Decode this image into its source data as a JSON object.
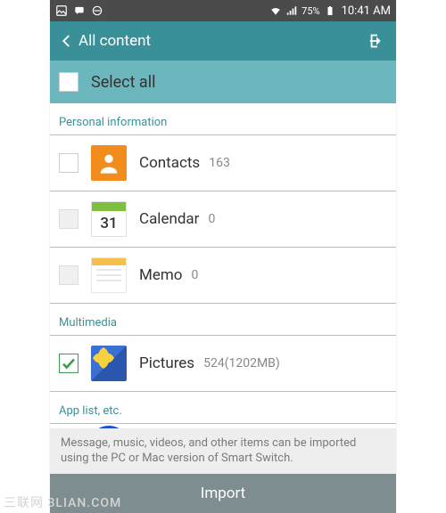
{
  "statusbar": {
    "battery_pct": "75%",
    "time": "10:41 AM"
  },
  "header": {
    "title": "All content"
  },
  "select_all": {
    "label": "Select all"
  },
  "sections": {
    "personal": {
      "label": "Personal information"
    },
    "multimedia": {
      "label": "Multimedia"
    },
    "applist": {
      "label": "App list, etc."
    }
  },
  "items": {
    "contacts": {
      "name": "Contacts",
      "count": "163"
    },
    "calendar": {
      "name": "Calendar",
      "count": "0",
      "day": "31"
    },
    "memo": {
      "name": "Memo",
      "count": "0"
    },
    "pictures": {
      "name": "Pictures",
      "count": "524(1202MB)"
    }
  },
  "note": "Message, music, videos, and other items can be imported using the PC or Mac version of Smart Switch.",
  "import_label": "Import",
  "watermark": "三联网 3LIAN.COM"
}
